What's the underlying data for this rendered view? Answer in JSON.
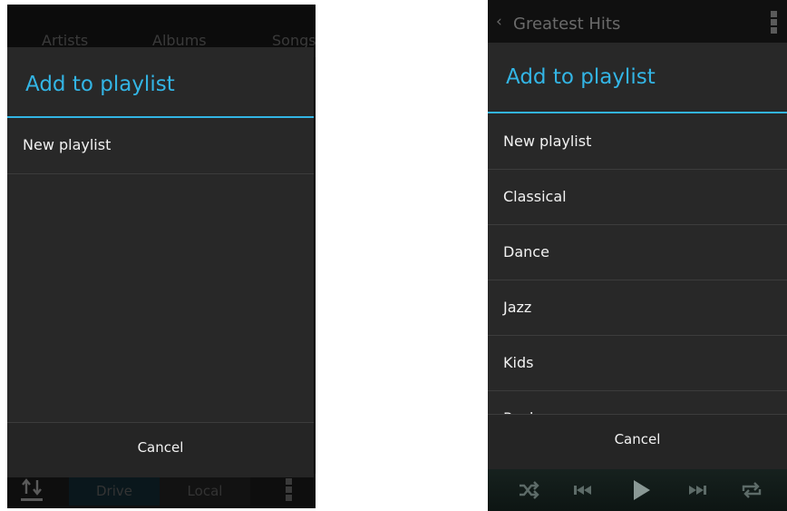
{
  "left_screen": {
    "tabs": [
      "Artists",
      "Albums",
      "Songs"
    ],
    "dialog": {
      "title": "Add to playlist",
      "items": [
        "New playlist"
      ],
      "cancel_label": "Cancel"
    },
    "bottom_bar": {
      "sort_icon": "sort-updown-icon",
      "segments": [
        "Drive",
        "Local"
      ],
      "menu_icon": "overflow-menu-icon"
    }
  },
  "right_screen": {
    "header": {
      "back_icon": "chevron-left-icon",
      "title": "Greatest Hits",
      "menu_icon": "overflow-menu-icon"
    },
    "dialog": {
      "title": "Add to playlist",
      "items": [
        "New playlist",
        "Classical",
        "Dance",
        "Jazz",
        "Kids",
        "Rock"
      ],
      "cancel_label": "Cancel"
    },
    "player_controls": [
      "shuffle-icon",
      "previous-icon",
      "play-icon",
      "next-icon",
      "repeat-icon"
    ]
  },
  "colors": {
    "accent": "#33b5e5",
    "dialog_bg": "#282828",
    "divider": "#3c3c3c"
  }
}
